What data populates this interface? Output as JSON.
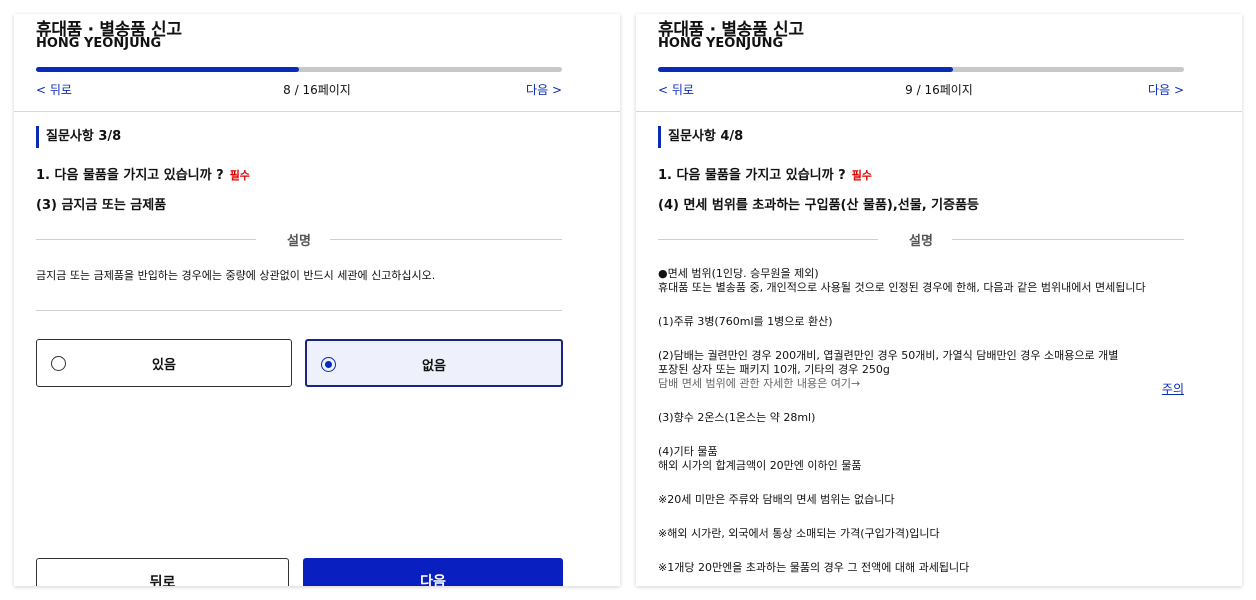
{
  "left": {
    "title": "휴대품 · 별송품 신고",
    "subtitle": "HONG YEONJUNG",
    "progress_fraction": 0.5,
    "back_label": "< 뒤로",
    "page_label": "8 / 16페이지",
    "next_label": "다음 >",
    "question_heading": "질문사항 3/8",
    "question_text": "1. 다음 물품을 가지고 있습니까 ?",
    "required_label": "필수",
    "question_sub": "(3) 금지금 또는 금제품",
    "section_label": "설명",
    "description": "금지금 또는 금제품을 반입하는 경우에는 중량에 상관없이 반드시 세관에 신고하십시오.",
    "option_yes": "있음",
    "option_no": "없음",
    "selected_option": "없음",
    "bottom_back": "뒤로",
    "bottom_next": "다음"
  },
  "right": {
    "title": "휴대품 · 별송품 신고",
    "subtitle": "HONG YEONJUNG",
    "progress_fraction": 0.56,
    "back_label": "< 뒤로",
    "page_label": "9 / 16페이지",
    "next_label": "다음 >",
    "question_heading": "질문사항 4/8",
    "question_text": "1. 다음 물품을 가지고 있습니까 ?",
    "required_label": "필수",
    "question_sub": "(4) 면세 범위를 초과하는 구입품(산 물품),선물, 기증품등",
    "section_label": "설명",
    "info": {
      "b1_l1": "●면세 범위(1인당. 승무원을 제외)",
      "b1_l2": "휴대품 또는 별송품 중, 개인적으로 사용될 것으로 인정된 경우에 한해, 다음과 같은 범위내에서 면세됩니다",
      "b2": "(1)주류 3병(760ml를 1병으로 환산)",
      "b3_l1": "(2)담배는 궐련만인 경우 200개비, 엽궐련만인 경우 50개비, 가열식 담배만인 경우 소매용으로 개별",
      "b3_l2": "포장된 상자 또는 패키지 10개, 기타의 경우 250g",
      "b3_l3": "담배 면세 범위에 관한 자세한 내용은 여기→",
      "caution": "주의",
      "b4": "(3)향수 2온스(1온스는 약 28ml)",
      "b5_l1": "(4)기타 물품",
      "b5_l2": "해외 시가의 합계금액이 20만엔 이하인 물품",
      "b6": "※20세 미만은 주류와 담배의 면세 범위는 없습니다",
      "b7": "※해외 시가란, 외국에서 통상 소매되는 가격(구입가격)입니다",
      "b8": "※1개당 20만엔을 초과하는 물품의 경우 그 전액에 대해 과세됩니다"
    }
  }
}
